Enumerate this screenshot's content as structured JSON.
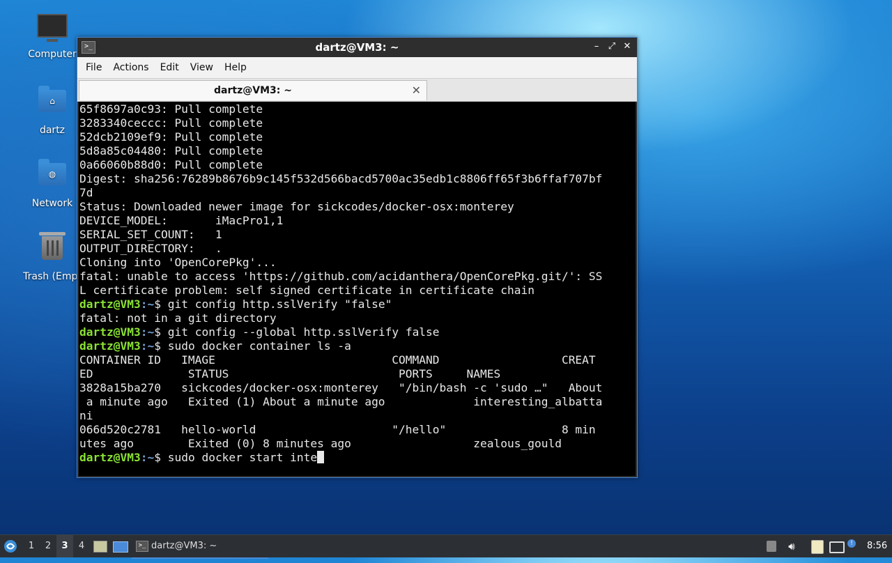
{
  "desktop": {
    "icons": [
      {
        "label": "Computer",
        "icon": "computer-icon"
      },
      {
        "label": "dartz",
        "icon": "home-folder-icon"
      },
      {
        "label": "Network",
        "icon": "network-folder-icon"
      },
      {
        "label": "Trash (Empt",
        "icon": "trash-icon"
      }
    ]
  },
  "window": {
    "title": "dartz@VM3: ~",
    "menu": [
      "File",
      "Actions",
      "Edit",
      "View",
      "Help"
    ],
    "tab_label": "dartz@VM3: ~",
    "accent": "#4a8ad8"
  },
  "terminal": {
    "prompt_user": "dartz@VM3",
    "prompt_path": ":~",
    "prompt_sym": "$ ",
    "lines": [
      {
        "t": "65f8697a0c93: Pull complete"
      },
      {
        "t": "3283340ceccc: Pull complete"
      },
      {
        "t": "52dcb2109ef9: Pull complete"
      },
      {
        "t": "5d8a85c04480: Pull complete"
      },
      {
        "t": "0a66060b88d0: Pull complete"
      },
      {
        "t": "Digest: sha256:76289b8676b9c145f532d566bacd5700ac35edb1c8806ff65f3b6ffaf707bf"
      },
      {
        "t": "7d"
      },
      {
        "t": "Status: Downloaded newer image for sickcodes/docker-osx:monterey"
      },
      {
        "t": "DEVICE_MODEL:       iMacPro1,1"
      },
      {
        "t": "SERIAL_SET_COUNT:   1"
      },
      {
        "t": "OUTPUT_DIRECTORY:   ."
      },
      {
        "t": "Cloning into 'OpenCorePkg'..."
      },
      {
        "t": "fatal: unable to access 'https://github.com/acidanthera/OpenCorePkg.git/': SS"
      },
      {
        "t": "L certificate problem: self signed certificate in certificate chain"
      },
      {
        "p": true,
        "t": "git config http.sslVerify \"false\""
      },
      {
        "t": "fatal: not in a git directory"
      },
      {
        "p": true,
        "t": "git config --global http.sslVerify false"
      },
      {
        "p": true,
        "t": "sudo docker container ls -a"
      },
      {
        "t": "CONTAINER ID   IMAGE                          COMMAND                  CREAT"
      },
      {
        "t": "ED              STATUS                         PORTS     NAMES"
      },
      {
        "t": "3828a15ba270   sickcodes/docker-osx:monterey   \"/bin/bash -c 'sudo …\"   About"
      },
      {
        "t": " a minute ago   Exited (1) About a minute ago             interesting_albatta"
      },
      {
        "t": "ni"
      },
      {
        "t": "066d520c2781   hello-world                    \"/hello\"                 8 min"
      },
      {
        "t": "utes ago        Exited (0) 8 minutes ago                  zealous_gould"
      },
      {
        "p": true,
        "t": "sudo docker start inte",
        "cursor": true
      }
    ]
  },
  "taskbar": {
    "workspaces": [
      "1",
      "2",
      "3",
      "4"
    ],
    "active_workspace": "3",
    "task_label": "dartz@VM3: ~",
    "clock": "8:56"
  }
}
